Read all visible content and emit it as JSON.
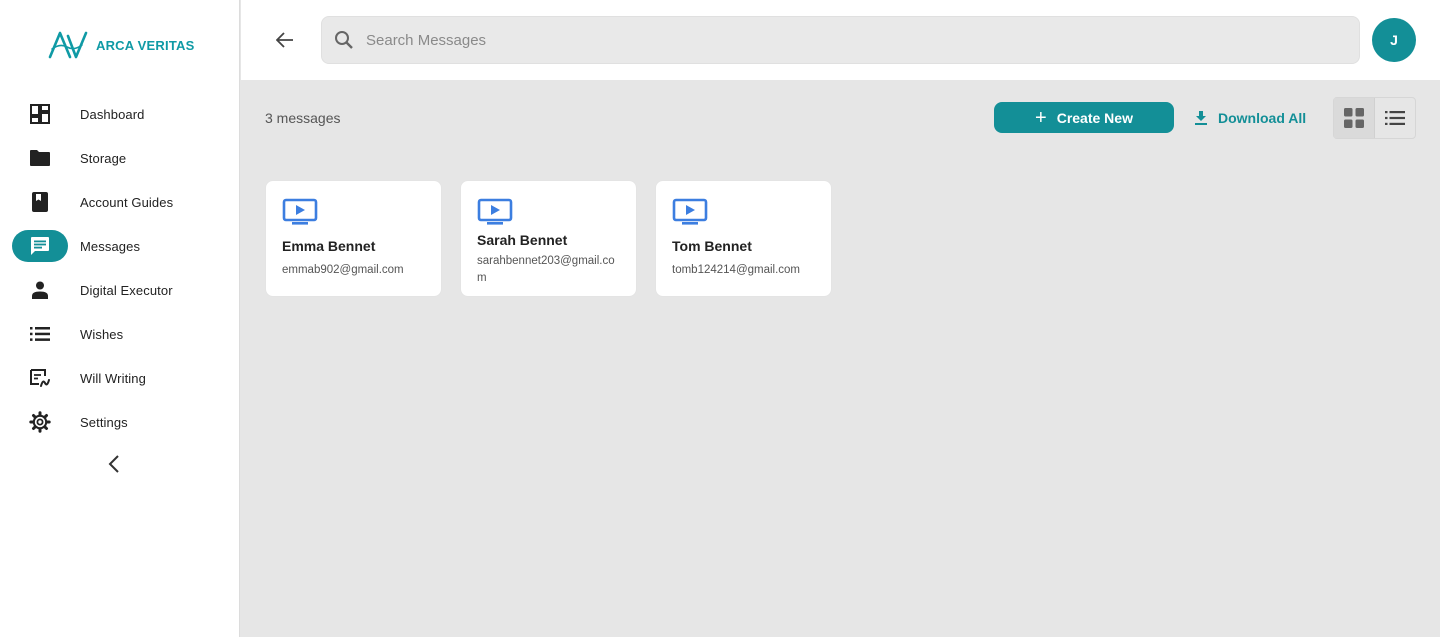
{
  "brand": {
    "name": "ARCA VERITAS",
    "accent": "#138f97"
  },
  "sidebar": {
    "items": [
      {
        "label": "Dashboard",
        "icon": "dashboard-icon"
      },
      {
        "label": "Storage",
        "icon": "folder-icon"
      },
      {
        "label": "Account Guides",
        "icon": "book-icon"
      },
      {
        "label": "Messages",
        "icon": "message-icon",
        "active": true
      },
      {
        "label": "Digital Executor",
        "icon": "person-icon"
      },
      {
        "label": "Wishes",
        "icon": "list-icon"
      },
      {
        "label": "Will Writing",
        "icon": "signature-icon"
      },
      {
        "label": "Settings",
        "icon": "gear-icon"
      }
    ]
  },
  "header": {
    "search_placeholder": "Search Messages",
    "avatar_initial": "J"
  },
  "toolbar": {
    "count_label": "3 messages",
    "create_label": "Create New",
    "download_label": "Download All"
  },
  "messages": [
    {
      "name": "Emma Bennet",
      "email": "emmab902@gmail.com"
    },
    {
      "name": "Sarah Bennet",
      "email": "sarahbennet203@gmail.com"
    },
    {
      "name": "Tom Bennet",
      "email": "tomb124214@gmail.com"
    }
  ]
}
